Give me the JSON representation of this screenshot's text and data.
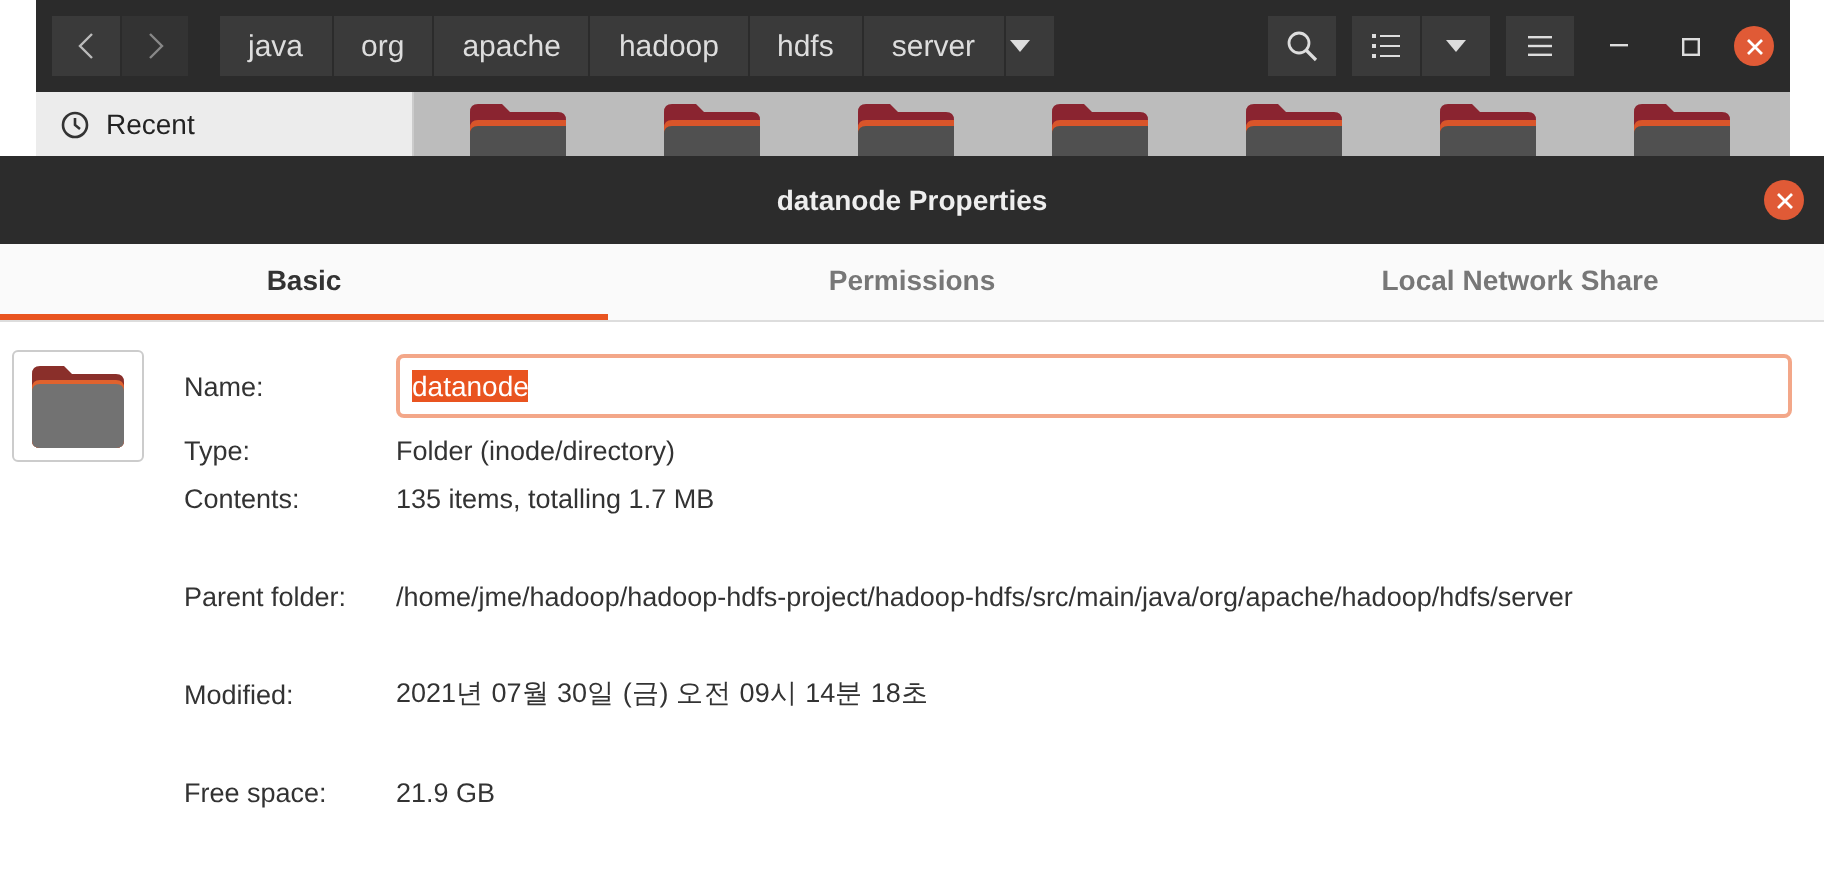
{
  "file_manager": {
    "breadcrumbs": [
      "java",
      "org",
      "apache",
      "hadoop",
      "hdfs",
      "server"
    ],
    "sidebar": {
      "items": [
        "Recent"
      ]
    }
  },
  "dialog": {
    "title": "datanode Properties",
    "tabs": [
      {
        "label": "Basic",
        "selected": true
      },
      {
        "label": "Permissions",
        "selected": false
      },
      {
        "label": "Local Network Share",
        "selected": false
      }
    ],
    "name": {
      "label": "Name:",
      "value": "datanode"
    },
    "property_groups": [
      [
        {
          "label": "Type:",
          "value": "Folder (inode/directory)"
        },
        {
          "label": "Contents:",
          "value": "135 items, totalling 1.7 MB"
        }
      ],
      [
        {
          "label": "Parent folder:",
          "value": "/home/jme/hadoop/hadoop-hdfs-project/hadoop-hdfs/src/main/java/org/apache/hadoop/hdfs/server"
        }
      ],
      [
        {
          "label": "Modified:",
          "value": "2021년 07월 30일 (금) 오전 09시 14분 18초"
        }
      ],
      [
        {
          "label": "Free space:",
          "value": "21.9 GB"
        }
      ]
    ]
  }
}
